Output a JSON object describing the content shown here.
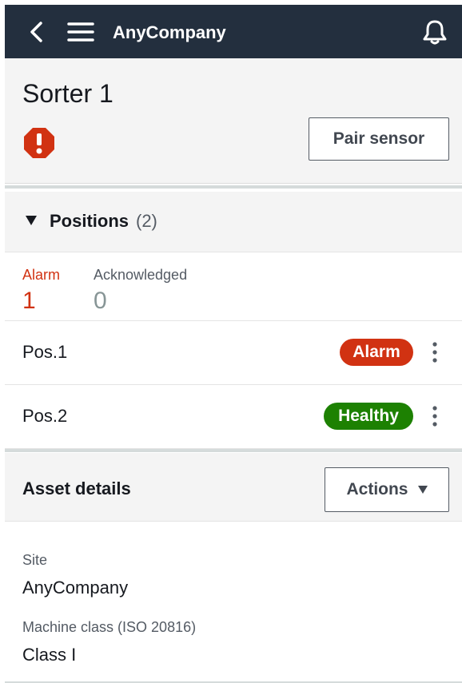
{
  "app": {
    "brand": "AnyCompany"
  },
  "asset": {
    "title": "Sorter 1",
    "status_icon": "alarm-octagon-icon",
    "pair_sensor_label": "Pair sensor"
  },
  "positions": {
    "label": "Positions",
    "count": "(2)",
    "summary": {
      "alarm_label": "Alarm",
      "alarm_value": "1",
      "ack_label": "Acknowledged",
      "ack_value": "0"
    },
    "items": [
      {
        "name": "Pos.1",
        "status": "Alarm"
      },
      {
        "name": "Pos.2",
        "status": "Healthy"
      }
    ]
  },
  "details": {
    "label": "Asset details",
    "actions_label": "Actions",
    "fields": [
      {
        "key": "Site",
        "value": "AnyCompany"
      },
      {
        "key": "Machine class (ISO 20816)",
        "value": "Class I"
      }
    ]
  },
  "colors": {
    "topbar": "#232f3e",
    "alarm": "#d13212",
    "healthy": "#1d8102",
    "muted": "#879596"
  }
}
